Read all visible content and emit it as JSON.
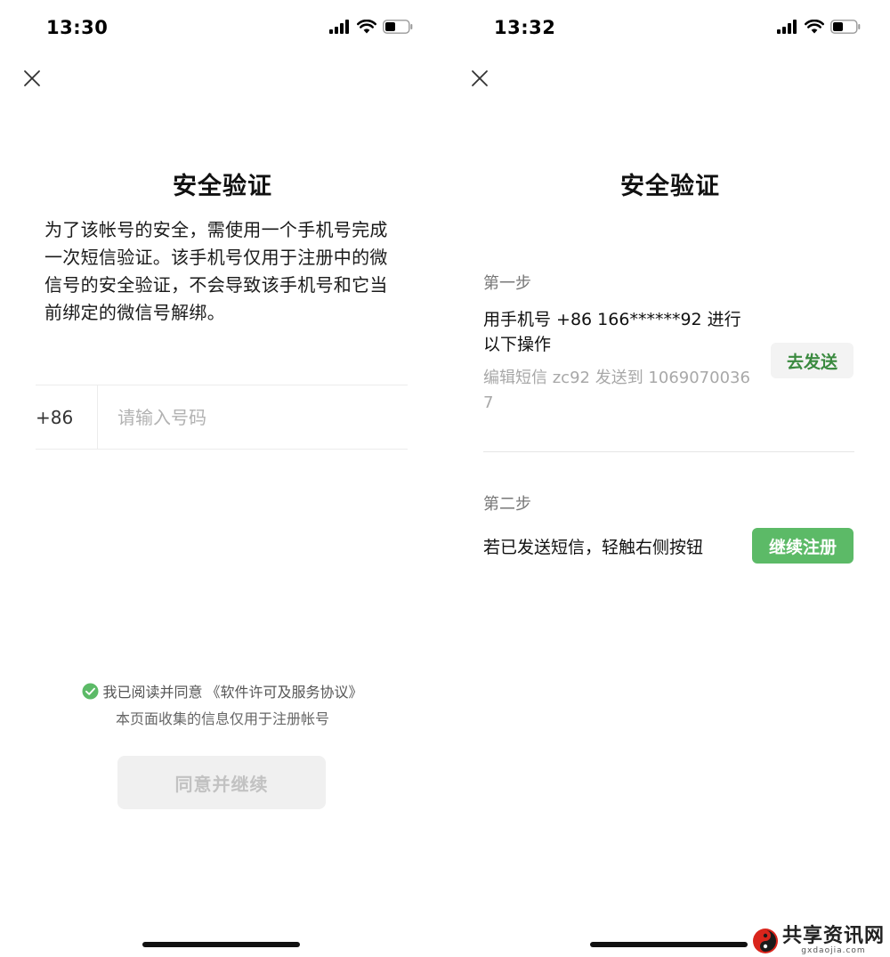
{
  "left": {
    "status": {
      "time": "13:30"
    },
    "title": "安全验证",
    "description": "为了该帐号的安全，需使用一个手机号完成一次短信验证。该手机号仅用于注册中的微信号的安全验证，不会导致该手机号和它当前绑定的微信号解绑。",
    "phone": {
      "country_code": "+86",
      "placeholder": "请输入号码"
    },
    "agreement": {
      "text": "我已阅读并同意",
      "link": "《软件许可及服务协议》",
      "note": "本页面收集的信息仅用于注册帐号",
      "checked": true
    },
    "agree_button": "同意并继续"
  },
  "right": {
    "status": {
      "time": "13:32"
    },
    "title": "安全验证",
    "step1": {
      "label": "第一步",
      "instruction": "用手机号 +86 166******92 进行以下操作",
      "sms": "编辑短信 zc92 发送到 10690700367",
      "button": "去发送"
    },
    "step2": {
      "label": "第二步",
      "instruction": "若已发送短信，轻触右侧按钮",
      "button": "继续注册"
    }
  },
  "watermark": {
    "name": "共享资讯网",
    "url": "gxdaojia.com"
  },
  "colors": {
    "accent_green": "#5cba67",
    "link_green": "#3a8a3f",
    "check_green": "#5cba67",
    "watermark_red": "#d9251c"
  },
  "icons": [
    "close-icon",
    "signal-icon",
    "wifi-icon",
    "battery-icon",
    "check-icon"
  ]
}
